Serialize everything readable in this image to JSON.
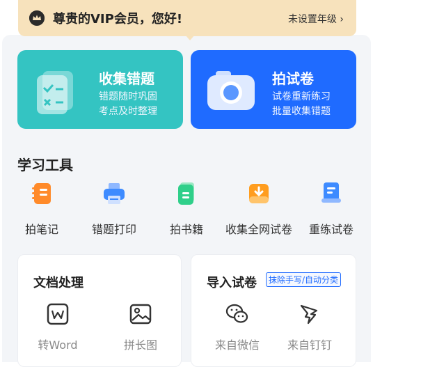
{
  "vip": {
    "greeting": "尊贵的VIP会员，您好!",
    "grade_link": "未设置年级 ›",
    "crown_icon": "crown-icon"
  },
  "cards": [
    {
      "title": "收集错题",
      "line1": "错题随时巩固",
      "line2": "考点及时整理",
      "icon": "document-icon",
      "color": "#34c4c2"
    },
    {
      "title": "拍试卷",
      "line1": "试卷重新练习",
      "line2": "批量收集错题",
      "icon": "camera-icon",
      "color": "#1f6bff"
    }
  ],
  "tools": {
    "title": "学习工具",
    "items": [
      {
        "label": "拍笔记",
        "icon": "notebook-icon",
        "color": "#ff8a2a"
      },
      {
        "label": "错题打印",
        "icon": "printer-icon",
        "color": "#3e8bff"
      },
      {
        "label": "拍书籍",
        "icon": "book-icon",
        "color": "#2fcf8a"
      },
      {
        "label": "收集全网试卷",
        "icon": "download-tray-icon",
        "color": "#ff9d1f"
      },
      {
        "label": "重练试卷",
        "icon": "paper-stack-icon",
        "color": "#3e8bff"
      }
    ]
  },
  "doc": {
    "title": "文档处理",
    "items": [
      {
        "label": "转Word",
        "icon": "word-icon"
      },
      {
        "label": "拼长图",
        "icon": "image-icon"
      }
    ]
  },
  "import": {
    "title": "导入试卷",
    "tag": "抹除手写/自动分类",
    "items": [
      {
        "label": "来自微信",
        "icon": "wechat-icon"
      },
      {
        "label": "来自钉钉",
        "icon": "dingtalk-icon"
      }
    ]
  }
}
